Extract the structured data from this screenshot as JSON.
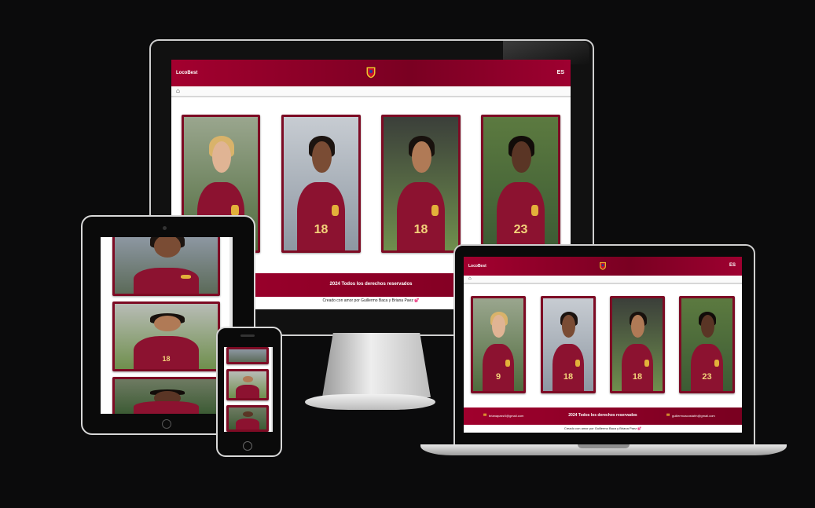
{
  "site": {
    "brand": "LocoBest",
    "lang": "ES",
    "footer_text": "2024 Todos los derechos reservados",
    "credit": "Creado con amor por Guillermo Baca y Briana Paez 💕",
    "email_left": "brianapaez0@gmail.com",
    "email_right": "guillermoacostahh@gmail.com"
  },
  "players": [
    {
      "number": "9",
      "skin": "#e0b494",
      "hair": "#d9b36a",
      "bg": "#4f6b3d"
    },
    {
      "number": "18",
      "skin": "#7a4c34",
      "hair": "#1c1410",
      "bg": "#8d97a2"
    },
    {
      "number": "18",
      "skin": "#b07a56",
      "hair": "#18110d",
      "bg": "#6f8f4d"
    },
    {
      "number": "23",
      "skin": "#5a3525",
      "hair": "#120c09",
      "bg": "#3c5b34"
    }
  ],
  "colors": {
    "brand": "#8a0027",
    "card": "#7d0b24",
    "background": "#0b0b0c"
  }
}
